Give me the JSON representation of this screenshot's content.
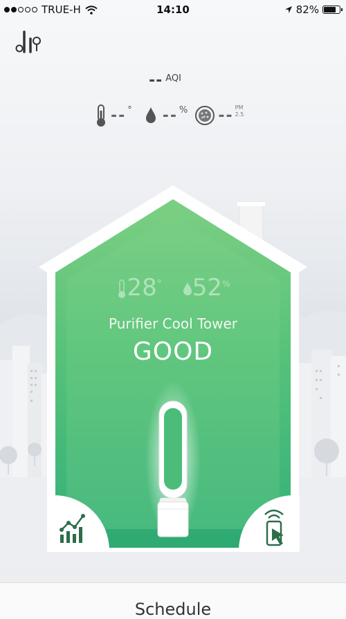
{
  "status_bar": {
    "carrier": "TRUE-H",
    "signal_strength": 2,
    "time": "14:10",
    "battery": "82%",
    "battery_fraction": 0.82,
    "icons": [
      "signal-dots-icon",
      "wifi-icon",
      "location-arrow-icon",
      "battery-icon"
    ]
  },
  "header": {
    "menu_icon": "sensor-wand-icon"
  },
  "air_quality": {
    "aqi_value": "--",
    "aqi_label": "AQI"
  },
  "sensors": {
    "temperature_value": "--",
    "temperature_unit": "°",
    "humidity_value": "--",
    "humidity_unit": "%",
    "pm_value": "--",
    "pm_label_top": "PM",
    "pm_label_bottom": "2.5"
  },
  "device": {
    "temperature": "28",
    "temperature_unit": "°",
    "humidity": "52",
    "humidity_unit": "%",
    "name": "Purifier Cool Tower",
    "status": "GOOD",
    "accent_color": "#4ec07a"
  },
  "actions": {
    "left_icon": "chart-icon",
    "right_icon": "remote-control-icon"
  },
  "bottom": {
    "label": "Schedule"
  }
}
